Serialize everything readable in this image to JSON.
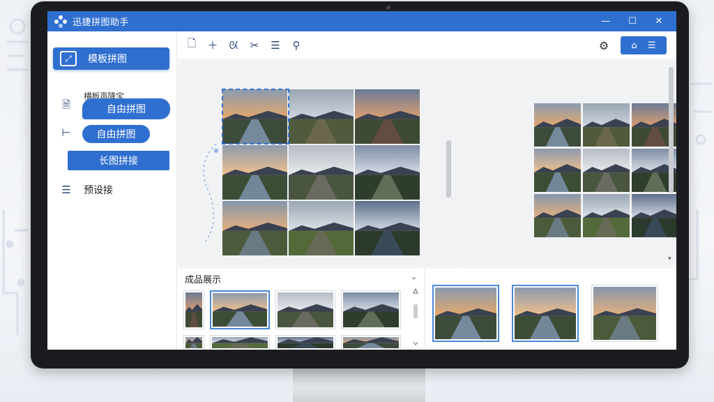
{
  "app": {
    "title": "迅捷拼图助手"
  },
  "window_controls": {
    "minimize": "—",
    "maximize": "☐",
    "close": "✕"
  },
  "sidebar": {
    "active_item": "模板拼图",
    "ghost_label": "横板声降宝",
    "tooltip_label": "自由拼图",
    "items": [
      {
        "label": "自由拼图"
      },
      {
        "label": "长图拼接"
      },
      {
        "label": "预设接"
      }
    ]
  },
  "toolbar": {
    "tools": [
      "file-add-icon",
      "plus-icon",
      "brush-icon",
      "scissors-icon",
      "list-icon",
      "search-person-icon"
    ]
  },
  "gallery": {
    "title": "成品展示"
  },
  "colors": {
    "accent": "#2f6fd0",
    "titlebar": "#2f6fd0",
    "canvas_bg": "#f1f2f4"
  }
}
